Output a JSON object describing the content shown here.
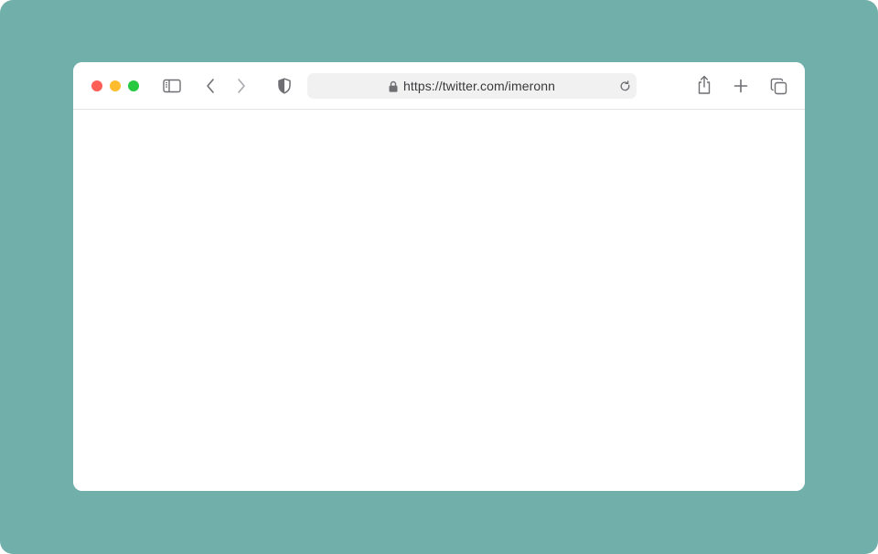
{
  "colors": {
    "background": "#71afab",
    "window_bg": "#ffffff",
    "address_bar_bg": "#f1f1f2",
    "icon": "#6e6e73",
    "icon_disabled": "#a8a8ad",
    "url_text": "#3a3a3c",
    "traffic_close": "#fe5f57",
    "traffic_minimize": "#febc2e",
    "traffic_zoom": "#28c840"
  },
  "window": {
    "traffic_lights": [
      "close",
      "minimize",
      "zoom"
    ]
  },
  "toolbar": {
    "icons": {
      "sidebar": "sidebar-icon",
      "back": "chevron-left-icon",
      "forward": "chevron-right-icon",
      "privacy": "shield-icon",
      "lock": "lock-icon",
      "reload": "reload-icon",
      "share": "share-icon",
      "new_tab": "plus-icon",
      "tab_overview": "tabs-icon"
    },
    "forward_enabled": false
  },
  "address_bar": {
    "url": "https://twitter.com/imeronn"
  },
  "content": {}
}
